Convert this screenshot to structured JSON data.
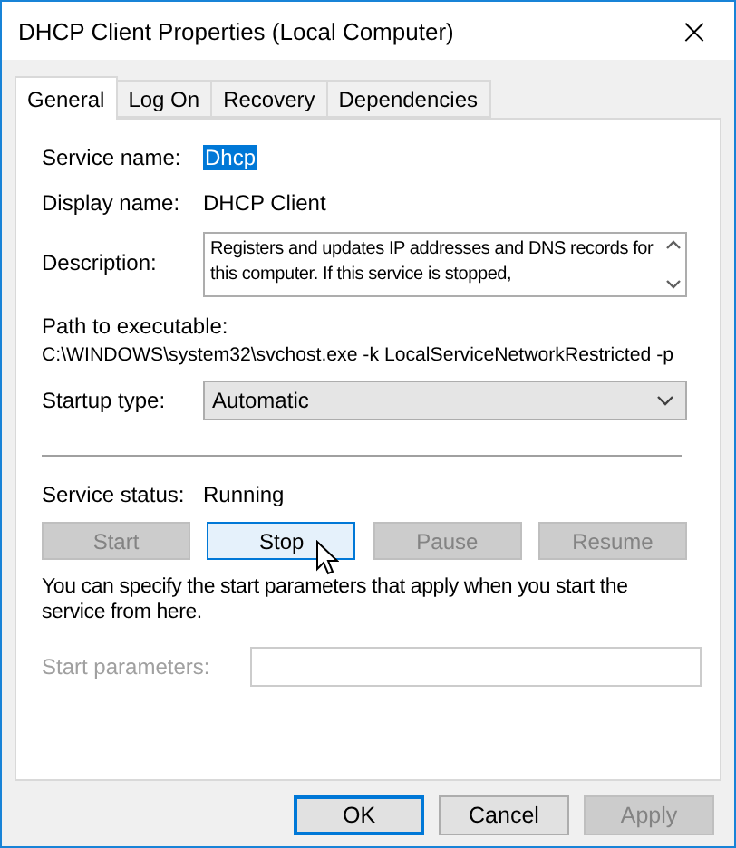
{
  "window": {
    "title": "DHCP Client Properties (Local Computer)",
    "close": "×"
  },
  "tabs": [
    {
      "label": "General",
      "selected": true
    },
    {
      "label": "Log On",
      "selected": false
    },
    {
      "label": "Recovery",
      "selected": false
    },
    {
      "label": "Dependencies",
      "selected": false
    }
  ],
  "service_name": {
    "label": "Service name:",
    "value": "Dhcp",
    "selected": true
  },
  "display_name": {
    "label": "Display name:",
    "value": "DHCP Client"
  },
  "description": {
    "label": "Description:",
    "value": "Registers and updates IP addresses and DNS records for this computer. If this service is stopped,"
  },
  "path": {
    "label": "Path to executable:",
    "value": "C:\\WINDOWS\\system32\\svchost.exe -k LocalServiceNetworkRestricted -p"
  },
  "startup_type": {
    "label": "Startup type:",
    "value": "Automatic"
  },
  "service_status": {
    "label": "Service status:",
    "value": "Running"
  },
  "control_buttons": [
    {
      "label": "Start",
      "disabled": true,
      "hovered": false
    },
    {
      "label": "Stop",
      "disabled": false,
      "hovered": true
    },
    {
      "label": "Pause",
      "disabled": true,
      "hovered": false
    },
    {
      "label": "Resume",
      "disabled": true,
      "hovered": false
    }
  ],
  "hint": "You can specify the start parameters that apply when you start the service from here.",
  "start_parameters": {
    "label": "Start parameters:",
    "disabled": true
  },
  "dialog_buttons": [
    {
      "label": "OK",
      "default": true,
      "disabled": false
    },
    {
      "label": "Cancel",
      "default": false,
      "disabled": false
    },
    {
      "label": "Apply",
      "default": false,
      "disabled": true
    }
  ]
}
